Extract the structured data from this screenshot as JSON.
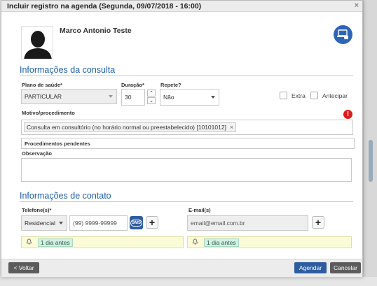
{
  "modal": {
    "title": "Incluir registro na agenda (Segunda, 09/07/2018 - 16:00)",
    "close_symbol": "×"
  },
  "patient": {
    "name": "Marco Antonio Teste",
    "avatar_icon": "person-silhouette-icon",
    "telemed_icon": "telemedicine-icon"
  },
  "consulta": {
    "section_title": "Informações da consulta",
    "plano_label": "Plano de saúde*",
    "plano_value": "PARTICULAR",
    "duracao_label": "Duração*",
    "duracao_value": "30",
    "spin_up": "⌃",
    "spin_down": "⌄",
    "repete_label": "Repete?",
    "repete_value": "Não",
    "extra_label": "Extra",
    "antecipar_label": "Antecipar",
    "motivo_label": "Motivo/procedimento",
    "motivo_tag": "Consulta em consultório (no horário normal ou preestabelecido) [10101012]",
    "tag_remove": "×",
    "alert_symbol": "!",
    "pendentes_label": "Procedimentos pendentes",
    "observacao_label": "Observação",
    "observacao_value": ""
  },
  "contato": {
    "section_title": "Informações de contato",
    "telefone_label": "Telefone(s)*",
    "tipo_value": "Residencial",
    "telefone_placeholder": "(99) 9999-99999",
    "sms_label": "SMS",
    "plus_label": "+",
    "email_label": "E-mail(s)",
    "email_placeholder": "email@email.com.br",
    "bell_icon": "bell-icon",
    "bell_glyph": "🔔",
    "reminder_phone": "1 dia antes",
    "reminder_email": "1 dia antes"
  },
  "footer": {
    "voltar_label": "< Voltar",
    "agendar_label": "Agendar",
    "cancelar_label": "Cancelar"
  },
  "colors": {
    "primary": "#2d5da0",
    "section_title": "#1f5ea8",
    "alert": "#e01b1b",
    "reminder_bg": "#fcfbd8",
    "reminder_tag": "#d4f1e4"
  }
}
